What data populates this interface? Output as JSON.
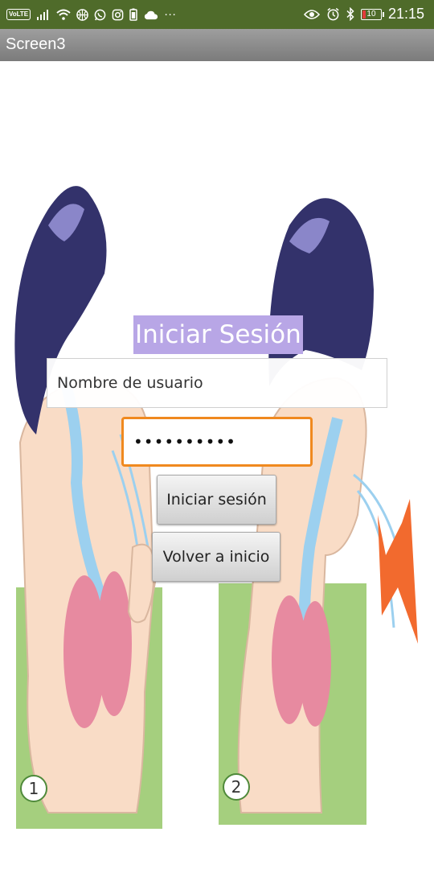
{
  "status_bar": {
    "left_icons": [
      "volte-icon",
      "signal-icon",
      "wifi-icon",
      "basketball-icon",
      "whatsapp-icon",
      "instagram-icon",
      "battery-saver-icon",
      "cloud-icon",
      "more-icon"
    ],
    "volte": "VoLTE",
    "more": "···",
    "right_icons": [
      "eye-icon",
      "alarm-icon",
      "bluetooth-icon",
      "battery-icon"
    ],
    "battery": "10",
    "time": "21:15"
  },
  "app": {
    "title": "Screen3"
  },
  "login": {
    "title": "Iniciar Sesión",
    "username_placeholder": "Nombre de usuario",
    "password_value": "1234567890",
    "login_button": "Iniciar sesión",
    "back_button": "Volver a inicio"
  },
  "illustration": {
    "badges": [
      "1",
      "2"
    ]
  },
  "colors": {
    "status_bar": "#4f6b2a",
    "title_bar": "#8c8c8c",
    "title_highlight": "#b8a6e6",
    "password_focus": "#f0891f",
    "lungs": "#e78aa0",
    "ground": "#9fcc78",
    "arrow": "#f26a2e"
  }
}
